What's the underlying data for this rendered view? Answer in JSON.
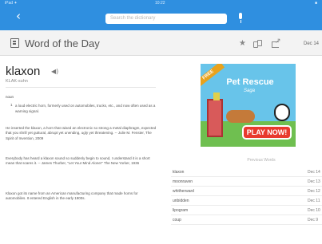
{
  "status_bar": {
    "carrier": "iPad ✦",
    "time": "10:22",
    "battery": "■"
  },
  "nav": {
    "back": "‹",
    "search_placeholder": "Search the dictionary"
  },
  "header": {
    "title": "Word of the Day",
    "date": "Dec 14"
  },
  "word": {
    "headword": "klaxon",
    "pronunciation": "KLAK-suhn",
    "part_of_speech": "noun",
    "definition_number": "1",
    "definition": "a loud electric horn, formerly used on automobiles, trucks, etc., and now often used as a warning signal.",
    "citations": [
      "He inserted the klaxon, a horn that raised an electronic so strong a metal diaphragm, expected that you shrill yet guttural, abrupt yet unending, ugly yet threatening. -- Julie M. Fenster, The Spirit of Invention, 2009",
      "Everybody has heard a klaxon sound so suddenly begin to sound, I understand it is a short mean that scares it. -- James Thurber, \"Let Your Mind Alone!\" The New Yorker, 1936"
    ],
    "origin": "Klaxon got its name from an American manufacturing company that made horns for automobiles. It entered English in the early 1900s."
  },
  "ad": {
    "ribbon": "FREE",
    "logo": "Pet Rescue",
    "tagline": "Saga",
    "cta": "PLAY NOW!"
  },
  "recent": {
    "heading": "Previous Words",
    "items": [
      {
        "word": "klaxon",
        "date": "Dec 14"
      },
      {
        "word": "moonraven",
        "date": "Dec 13"
      },
      {
        "word": "whitherward",
        "date": "Dec 12"
      },
      {
        "word": "unbidden",
        "date": "Dec 11"
      },
      {
        "word": "lipogram",
        "date": "Dec 10"
      },
      {
        "word": "coup",
        "date": "Dec 9"
      }
    ]
  },
  "colors": {
    "nav": "#2f8fe0",
    "header_bg": "#f3f3f3",
    "ad_button": "#e83a2e"
  },
  "icons": [
    "back-arrow-icon",
    "microphone-icon",
    "document-icon",
    "audio-speaker-icon",
    "star-icon",
    "flashcards-icon",
    "share-icon"
  ]
}
